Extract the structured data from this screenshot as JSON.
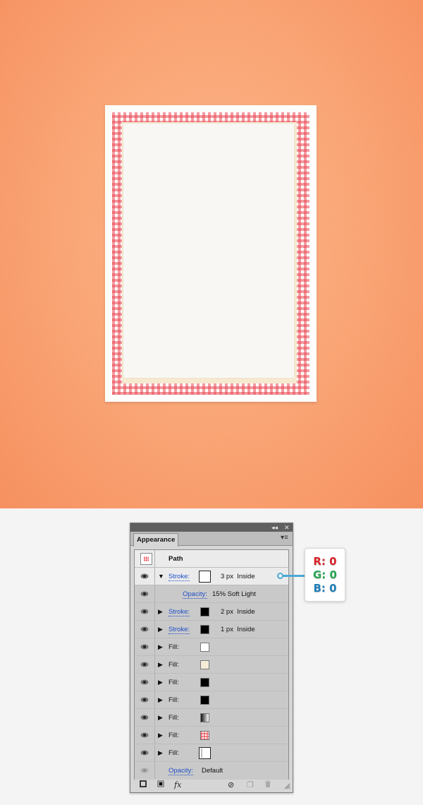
{
  "panel": {
    "tab_label": "Appearance",
    "object_type": "Path"
  },
  "rows": {
    "stroke_main": {
      "label": "Stroke:",
      "weight": "3 px",
      "align": "Inside",
      "color": "#000000"
    },
    "opacity_sub": {
      "label": "Opacity:",
      "value": "15% Soft Light"
    },
    "stroke_2": {
      "label": "Stroke:",
      "weight": "2 px",
      "align": "Inside",
      "color": "#000000"
    },
    "stroke_3": {
      "label": "Stroke:",
      "weight": "1 px",
      "align": "Inside",
      "color": "#000000"
    },
    "fills": [
      {
        "label": "Fill:",
        "color": "#ffffff"
      },
      {
        "label": "Fill:",
        "color": "#f6ecd8"
      },
      {
        "label": "Fill:",
        "color": "#000000"
      },
      {
        "label": "Fill:",
        "color": "#000000"
      },
      {
        "label": "Fill:",
        "color": "gradient-black-white"
      },
      {
        "label": "Fill:",
        "color": "gingham-pattern"
      },
      {
        "label": "Fill:",
        "color": "#ffffff"
      }
    ],
    "opacity_bottom": {
      "label": "Opacity:",
      "value": "Default"
    }
  },
  "callout": {
    "r": "R: 0",
    "g": "G: 0",
    "b": "B: 0",
    "r_color": "#d8232a",
    "g_color": "#27a552",
    "b_color": "#1f7eb8"
  },
  "icons": {
    "eye": "eye-icon",
    "expand_open": "▼",
    "expand_closed": "▶",
    "collapse": "◂◂",
    "close": "✕",
    "menu": "▾≡",
    "fx": "fx",
    "clear": "⊘",
    "duplicate": "❐",
    "trash": "🗑"
  }
}
